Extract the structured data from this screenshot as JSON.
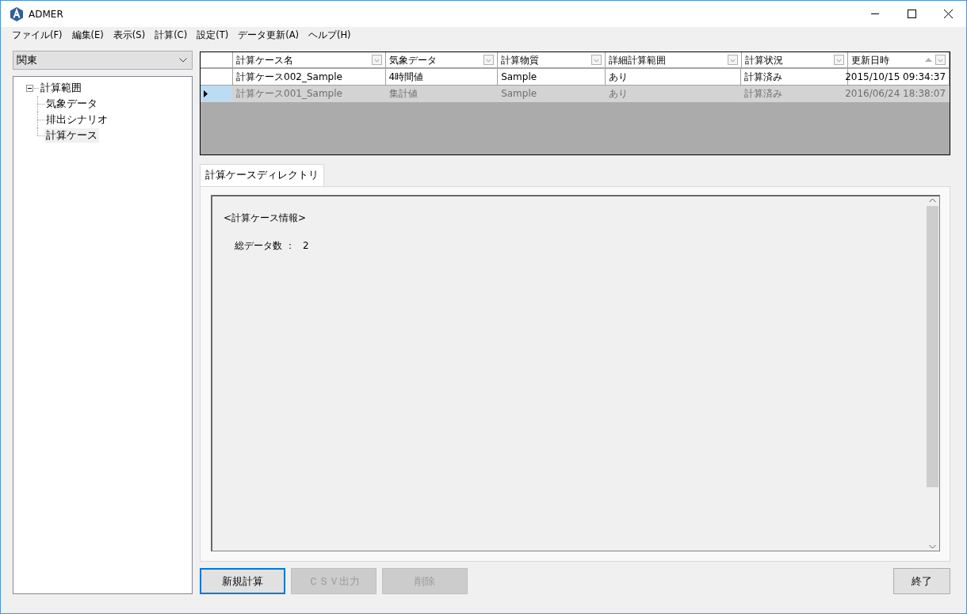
{
  "window": {
    "title": "ADMER"
  },
  "menu": [
    {
      "label": "ファイル(F)"
    },
    {
      "label": "編集(E)"
    },
    {
      "label": "表示(S)"
    },
    {
      "label": "計算(C)"
    },
    {
      "label": "設定(T)"
    },
    {
      "label": "データ更新(A)"
    },
    {
      "label": "ヘルプ(H)"
    }
  ],
  "region_select": {
    "value": "関東"
  },
  "tree": [
    {
      "label": "計算範囲",
      "expanded": true,
      "selected": false,
      "children": [
        {
          "label": "気象データ",
          "selected": false
        },
        {
          "label": "排出シナリオ",
          "selected": false
        },
        {
          "label": "計算ケース",
          "selected": true
        }
      ]
    }
  ],
  "grid": {
    "columns": [
      {
        "label": "計算ケース名",
        "sorted": false
      },
      {
        "label": "気象データ",
        "sorted": false
      },
      {
        "label": "計算物質",
        "sorted": false
      },
      {
        "label": "詳細計算範囲",
        "sorted": false
      },
      {
        "label": "計算状況",
        "sorted": false
      },
      {
        "label": "更新日時",
        "sorted": true
      }
    ],
    "rows": [
      {
        "cells": [
          "計算ケース002_Sample",
          "4時間値",
          "Sample",
          "あり",
          "計算済み",
          "2015/10/15 09:34:37"
        ],
        "selected": false
      },
      {
        "cells": [
          "計算ケース001_Sample",
          "集計値",
          "Sample",
          "あり",
          "計算済み",
          "2016/06/24 18:38:07"
        ],
        "selected": true
      }
    ]
  },
  "tabs": [
    {
      "label": "計算ケースディレクトリ",
      "selected": true
    }
  ],
  "info": {
    "heading": "<計算ケース情報>",
    "lines": [
      {
        "label": "総データ数",
        "separator": "：",
        "value": "2"
      }
    ]
  },
  "buttons": [
    {
      "label": "新規計算",
      "kind": "action",
      "disabled": false,
      "focused": true
    },
    {
      "label": "ＣＳＶ出力",
      "kind": "action",
      "disabled": true,
      "focused": false
    },
    {
      "label": "削除",
      "kind": "action",
      "disabled": true,
      "focused": false
    },
    {
      "label": "終了",
      "kind": "exit",
      "disabled": false,
      "focused": false
    }
  ]
}
